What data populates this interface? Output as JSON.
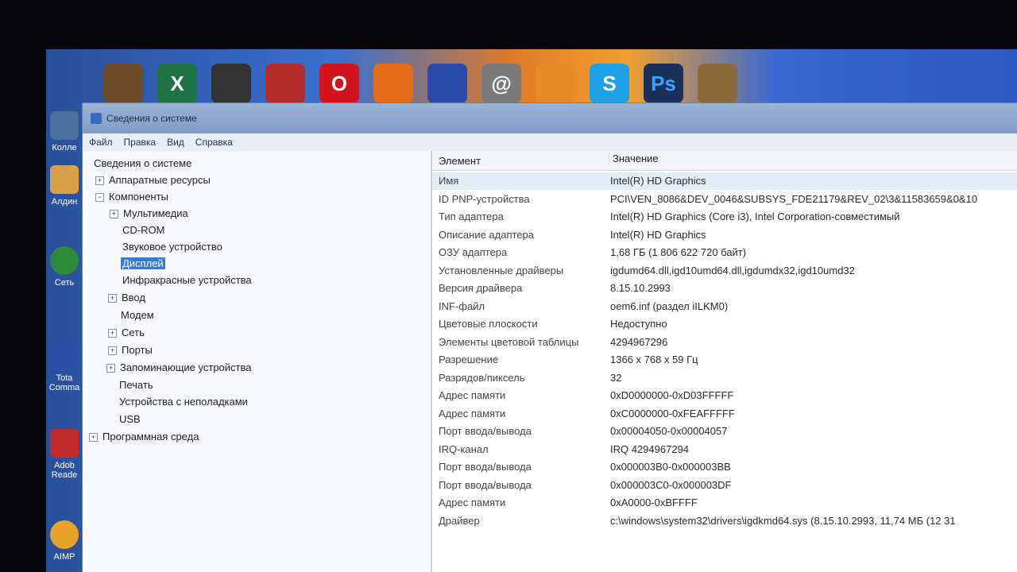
{
  "window": {
    "title": "Сведения о системе",
    "menu": [
      "Файл",
      "Правка",
      "Вид",
      "Справка"
    ]
  },
  "tree": {
    "root": "Сведения о системе",
    "items": [
      {
        "label": "Аппаратные ресурсы",
        "expander": "+"
      },
      {
        "label": "Компоненты",
        "expander": "−"
      },
      {
        "label": "Мультимедиа",
        "expander": "+"
      },
      {
        "label": "CD-ROM"
      },
      {
        "label": "Звуковое устройство"
      },
      {
        "label": "Дисплей"
      },
      {
        "label": "Инфракрасные устройства"
      },
      {
        "label": "Ввод",
        "expander": "+"
      },
      {
        "label": "Модем"
      },
      {
        "label": "Сеть",
        "expander": "+"
      },
      {
        "label": "Порты",
        "expander": "+"
      },
      {
        "label": "Запоминающие устройства",
        "expander": "+"
      },
      {
        "label": "Печать"
      },
      {
        "label": "Устройства с неполадками"
      },
      {
        "label": "USB"
      },
      {
        "label": "Программная среда",
        "expander": "+"
      }
    ]
  },
  "details": {
    "col_element": "Элемент",
    "col_value": "Значение",
    "rows": [
      {
        "k": "Имя",
        "v": "Intel(R) HD Graphics"
      },
      {
        "k": "ID PNP-устройства",
        "v": "PCI\\VEN_8086&DEV_0046&SUBSYS_FDE21179&REV_02\\3&11583659&0&10"
      },
      {
        "k": "Тип адаптера",
        "v": "Intel(R) HD Graphics (Core i3), Intel Corporation-совместимый"
      },
      {
        "k": "Описание адаптера",
        "v": "Intel(R) HD Graphics"
      },
      {
        "k": "ОЗУ адаптера",
        "v": "1,68 ГБ (1 806 622 720 байт)"
      },
      {
        "k": "Установленные драйверы",
        "v": "igdumd64.dll,igd10umd64.dll,igdumdx32,igd10umd32"
      },
      {
        "k": "Версия драйвера",
        "v": "8.15.10.2993"
      },
      {
        "k": "INF-файл",
        "v": "oem6.inf (раздел iILKM0)"
      },
      {
        "k": "Цветовые плоскости",
        "v": "Недоступно"
      },
      {
        "k": "Элементы цветовой таблицы",
        "v": "4294967296"
      },
      {
        "k": "Разрешение",
        "v": "1366 x 768 x 59 Гц"
      },
      {
        "k": "Разрядов/пиксель",
        "v": "32"
      },
      {
        "k": "Адрес памяти",
        "v": "0xD0000000-0xD03FFFFF"
      },
      {
        "k": "Адрес памяти",
        "v": "0xC0000000-0xFEAFFFFF"
      },
      {
        "k": "Порт ввода/вывода",
        "v": "0x00004050-0x00004057"
      },
      {
        "k": "IRQ-канал",
        "v": "IRQ 4294967294"
      },
      {
        "k": "Порт ввода/вывода",
        "v": "0x000003B0-0x000003BB"
      },
      {
        "k": "Порт ввода/вывода",
        "v": "0x000003C0-0x000003DF"
      },
      {
        "k": "Адрес памяти",
        "v": "0xA0000-0xBFFFF"
      },
      {
        "k": "Драйвер",
        "v": "c:\\windows\\system32\\drivers\\igdkmd64.sys (8.15.10.2993, 11,74 МБ (12 31"
      }
    ]
  },
  "desktop": {
    "icons": [
      {
        "name": "skype-icon",
        "glyph": "S",
        "color": "#1ea0e6"
      },
      {
        "name": "photoshop-icon",
        "glyph": "Ps",
        "color": "#1b2f5b"
      }
    ],
    "left_labels": [
      "Колле",
      "Алдин",
      "Сеть",
      "Tota Comma",
      "Adob Reade",
      "AIMP"
    ]
  }
}
